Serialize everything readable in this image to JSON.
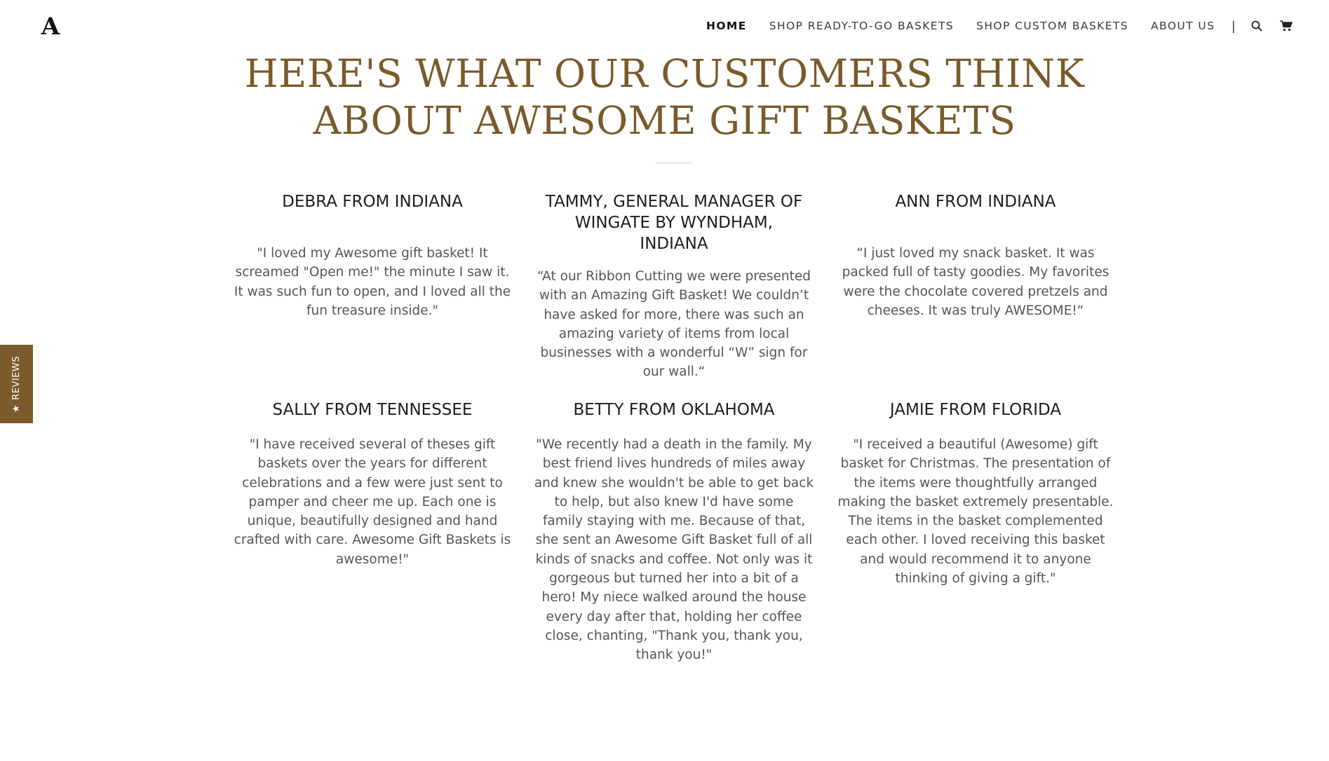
{
  "nav": {
    "logo_text": "A",
    "links": [
      "HOME",
      "SHOP READY-TO-GO BASKETS",
      "SHOP CUSTOM BASKETS",
      "ABOUT US"
    ],
    "separator": "|",
    "icons": [
      "search-icon",
      "cart-icon"
    ]
  },
  "heading": {
    "line1": "HERE'S WHAT OUR CUSTOMERS THINK",
    "line2": "ABOUT AWESOME GIFT BASKETS"
  },
  "reviews_tab": {
    "star": "★",
    "label": "REVIEWS"
  },
  "testimonials": [
    {
      "name": "DEBRA FROM INDIANA",
      "quote": "\"I loved my Awesome gift basket! It screamed \"Open me!\" the minute I saw it. It was such fun to open, and I loved all the fun treasure inside.\""
    },
    {
      "name": "TAMMY, GENERAL MANAGER OF WINGATE BY WYNDHAM, INDIANA",
      "quote": "“At our Ribbon Cutting we were presented with an Amazing Gift Basket!  We couldn’t have asked for more, there was such an amazing variety of items from local businesses with a wonderful “W” sign for our wall.“"
    },
    {
      "name": "ANN FROM INDIANA",
      "quote": "“I just loved my snack basket. It was packed full of tasty goodies. My favorites were the chocolate covered pretzels and cheeses. It was truly AWESOME!“"
    },
    {
      "name": "SALLY FROM TENNESSEE",
      "quote": "\"I have received several of theses gift baskets over the years for different celebrations and a few were just sent to pamper and cheer me up. Each one is unique, beautifully designed and hand crafted with care. Awesome Gift Baskets is awesome!\""
    },
    {
      "name": "BETTY FROM OKLAHOMA",
      "quote": "\"We recently had a death in the family. My best friend lives hundreds of miles away and knew she wouldn't be able to get back to help, but also knew I'd have some family staying with me. Because of that, she sent an Awesome Gift Basket full of all kinds of snacks and coffee. Not only was it gorgeous but turned her into a bit of a hero! My niece walked around the house every day after that, holding her coffee close, chanting, \"Thank you, thank you, thank you!\""
    },
    {
      "name": "JAMIE FROM FLORIDA",
      "quote": "\"I received a beautiful (Awesome) gift basket for Christmas. The presentation of the items were thoughtfully arranged making the basket extremely presentable. The items in the basket complemented each other. I loved receiving this basket and would recommend it to anyone thinking of giving a gift.\""
    }
  ],
  "colors": {
    "accent": "#7c5a29",
    "heading": "#7a5a2a",
    "text": "#555555"
  }
}
